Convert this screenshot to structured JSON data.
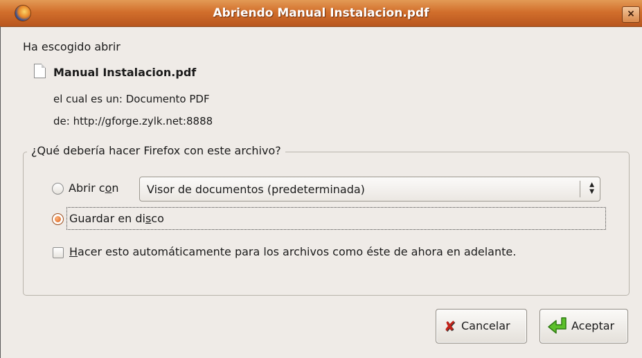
{
  "window": {
    "title": "Abriendo Manual Instalacion.pdf",
    "close_glyph": "×",
    "app_icon": "firefox-icon"
  },
  "intro": "Ha escogido abrir",
  "file": {
    "icon": "document-icon",
    "name": "Manual Instalacion.pdf",
    "type_prefix": "el cual es un:",
    "type_value": "Documento PDF",
    "from_prefix": "de:",
    "from_value": "http://gforge.zylk.net:8888"
  },
  "question": "¿Qué debería hacer Firefox con este archivo?",
  "options": {
    "open_with": {
      "label_a": "Abrir c",
      "label_u": "o",
      "label_b": "n",
      "selected": false
    },
    "app_select": {
      "value": "Visor de documentos (predeterminada)"
    },
    "save": {
      "label_a": "Guardar en di",
      "label_u": "s",
      "label_b": "co",
      "selected": true
    },
    "auto": {
      "label_a": "",
      "label_u": "H",
      "label_b": "acer esto automáticamente para los archivos como éste de ahora en adelante.",
      "checked": false
    }
  },
  "buttons": {
    "cancel": {
      "label": "Cancelar",
      "icon": "cancel-x-icon"
    },
    "ok": {
      "label": "Aceptar",
      "icon": "enter-arrow-icon"
    }
  },
  "colors": {
    "titlebar": "#d26f2c",
    "radio_selected": "#d9631e",
    "cancel_icon": "#c2231a",
    "ok_icon": "#4caf1f"
  }
}
